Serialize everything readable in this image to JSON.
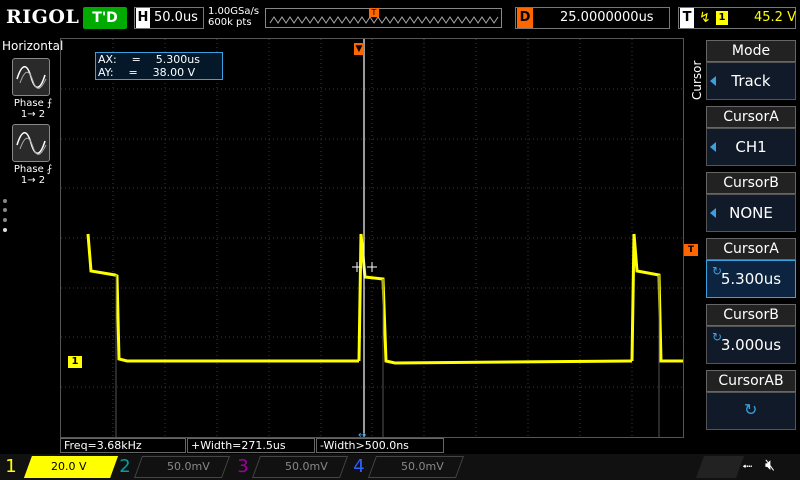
{
  "topbar": {
    "logo": "RIGOL",
    "run_status": "T'D",
    "timebase_label": "H",
    "timebase_value": "50.0us",
    "sample_rate": "1.00GSa/s",
    "memory_depth": "600k pts",
    "trigger_pos_marker": "T",
    "delay_label": "D",
    "delay_value": "25.0000000us",
    "trigger_label": "T",
    "trigger_edge": "↯",
    "trigger_source": "1",
    "trigger_level": "45.2 V"
  },
  "left_panel": {
    "title": "Horizontal",
    "items": [
      {
        "label_line1": "Phase ⨍",
        "label_line2": "1→ 2",
        "icon": "rising-phase-waveform-icon"
      },
      {
        "label_line1": "Phase ⨏",
        "label_line2": "1→ 2",
        "icon": "falling-phase-waveform-icon"
      }
    ]
  },
  "cursor_readout": {
    "ax_label": "AX:",
    "ax_eq": "=",
    "ax_value": "5.300us",
    "ay_label": "AY:",
    "ay_eq": "=",
    "ay_value": "38.00 V"
  },
  "channel_marker": "1",
  "trigger_level_marker": "T",
  "menu": {
    "side_label": "Cursor",
    "items": [
      {
        "title": "Mode",
        "value": "Track",
        "indicator": "triangle"
      },
      {
        "title": "CursorA",
        "value": "CH1",
        "indicator": "triangle"
      },
      {
        "title": "CursorB",
        "value": "NONE",
        "indicator": "triangle"
      },
      {
        "title": "CursorA",
        "value": "5.300us",
        "indicator": "knob",
        "active": true
      },
      {
        "title": "CursorB",
        "value": "3.000us",
        "indicator": "knob"
      },
      {
        "title": "CursorAB",
        "value": "",
        "indicator": "knob"
      }
    ]
  },
  "measurements": [
    {
      "text": "Freq=3.68kHz"
    },
    {
      "text": "+Width=271.5us"
    },
    {
      "text": "-Width>500.0ns"
    }
  ],
  "channels": [
    {
      "num": "1",
      "scale": "20.0 V",
      "color": "#ffff00",
      "active": true
    },
    {
      "num": "2",
      "scale": "50.0mV",
      "color": "#00c0c0",
      "active": false
    },
    {
      "num": "3",
      "scale": "50.0mV",
      "color": "#c000c0",
      "active": false
    },
    {
      "num": "4",
      "scale": "50.0mV",
      "color": "#3060ff",
      "active": false
    }
  ],
  "colors": {
    "ch1": "#ffff00",
    "accent": "#3aa0e0",
    "trigger": "#ff6600",
    "run_green": "#00aa00"
  }
}
